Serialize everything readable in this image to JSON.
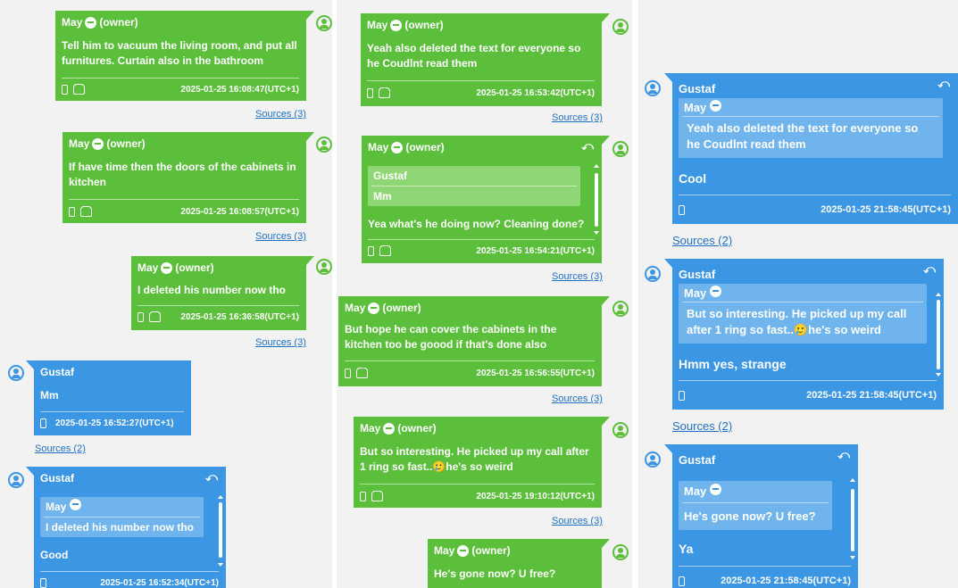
{
  "owner_tag": "(owner)",
  "reply_icon": "reply-arrow-icon",
  "left": {
    "m1": {
      "sender": "May",
      "text": "Tell him to vacuum the living room, and put all furnitures. Curtain also in the bathroom",
      "ts": "2025-01-25 16:08:47(UTC+1)",
      "sources": "Sources (3)"
    },
    "m2": {
      "sender": "May",
      "text": "If have time then the doors of the cabinets in kitchen",
      "ts": "2025-01-25 16:08:57(UTC+1)",
      "sources": "Sources (3)"
    },
    "m3": {
      "sender": "May",
      "text": "I deleted his number now tho",
      "ts": "2025-01-25 16:36:58(UTC+1)",
      "sources": "Sources (3)"
    },
    "m4": {
      "sender": "Gustaf",
      "text": "Mm",
      "ts": "2025-01-25 16:52:27(UTC+1)",
      "sources": "Sources (2)"
    },
    "m5": {
      "sender": "Gustaf",
      "quote_sender": "May",
      "quote_text": "I deleted his number now tho",
      "text": "Good",
      "ts": "2025-01-25 16:52:34(UTC+1)"
    }
  },
  "middle": {
    "m1": {
      "sender": "May",
      "text": "Yeah also deleted the text for everyone so he Coudlnt read them",
      "ts": "2025-01-25 16:53:42(UTC+1)",
      "sources": "Sources (3)"
    },
    "m2": {
      "sender": "May",
      "quote_sender": "Gustaf",
      "quote_text": "Mm",
      "text": "Yea what's he doing now? Cleaning done?",
      "ts": "2025-01-25 16:54:21(UTC+1)",
      "sources": "Sources (3)"
    },
    "m3": {
      "sender": "May",
      "text": "But hope he can cover the cabinets in the kitchen too be goood if that's done also",
      "ts": "2025-01-25 16:56:55(UTC+1)",
      "sources": "Sources (3)"
    },
    "m4": {
      "sender": "May",
      "text": "But so interesting. He picked up my call after 1 ring so fast..🥲he's so weird",
      "ts": "2025-01-25 19:10:12(UTC+1)",
      "sources": "Sources (3)"
    },
    "m5": {
      "sender": "May",
      "text": "He's gone now? U free?"
    }
  },
  "right": {
    "m1": {
      "sender": "Gustaf",
      "quote_sender": "May",
      "quote_text": "Yeah also deleted the text for everyone so he Coudlnt read them",
      "text": "Cool",
      "ts": "2025-01-25 21:58:45(UTC+1)",
      "sources": "Sources (2)"
    },
    "m2": {
      "sender": "Gustaf",
      "quote_sender": "May",
      "quote_text": "But so interesting. He picked up my call after 1 ring so fast..🥲he's so weird",
      "text": "Hmm yes, strange",
      "ts": "2025-01-25 21:58:45(UTC+1)",
      "sources": "Sources (2)"
    },
    "m3": {
      "sender": "Gustaf",
      "quote_sender": "May",
      "quote_text": "He's gone now? U free?",
      "text": "Ya",
      "ts": "2025-01-25 21:58:45(UTC+1)"
    }
  }
}
